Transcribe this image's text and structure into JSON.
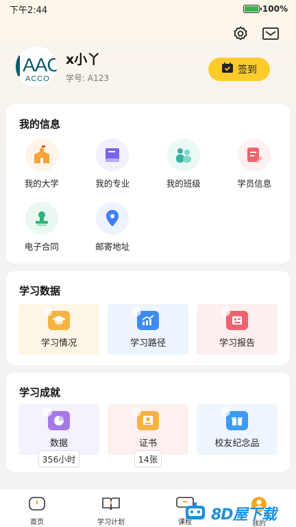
{
  "status_bar": {
    "time": "下午2:44",
    "battery": "100%"
  },
  "header": {
    "settings_icon": "gear-icon",
    "message_icon": "mail-icon"
  },
  "profile": {
    "logo_text_big": "AAC",
    "logo_text_small": "ACCO",
    "name": "x小丫",
    "student_id": "学号: A123",
    "checkin_label": "签到"
  },
  "info_section": {
    "title": "我的信息",
    "items": [
      {
        "label": "我的大学",
        "icon": "school-icon",
        "color": "#f7a33a"
      },
      {
        "label": "我的专业",
        "icon": "book-icon",
        "color": "#7a63e8"
      },
      {
        "label": "我的班级",
        "icon": "people-icon",
        "color": "#38b3a5"
      },
      {
        "label": "学员信息",
        "icon": "profile-edit-icon",
        "color": "#f0626e"
      },
      {
        "label": "电子合同",
        "icon": "stamp-icon",
        "color": "#2fb37a"
      },
      {
        "label": "邮寄地址",
        "icon": "location-pin-icon",
        "color": "#3d7ff2"
      }
    ]
  },
  "data_section": {
    "title": "学习数据",
    "tiles": [
      {
        "label": "学习情况",
        "icon": "graduation-cap-icon"
      },
      {
        "label": "学习路径",
        "icon": "chart-line-icon"
      },
      {
        "label": "学习报告",
        "icon": "report-icon"
      }
    ]
  },
  "achievement_section": {
    "title": "学习成就",
    "tiles": [
      {
        "label": "数据",
        "badge": "356小时",
        "icon": "pie-chart-icon"
      },
      {
        "label": "证书",
        "badge": "14张",
        "icon": "certificate-icon"
      },
      {
        "label": "校友纪念品",
        "icon": "gift-icon"
      }
    ]
  },
  "tabbar": {
    "tabs": [
      {
        "label": "首页",
        "icon": "home-icon"
      },
      {
        "label": "学习计划",
        "icon": "book-open-icon"
      },
      {
        "label": "课程",
        "icon": "course-icon"
      },
      {
        "label": "我的",
        "icon": "user-icon"
      }
    ]
  },
  "watermark": {
    "text": "8D屋下载"
  }
}
